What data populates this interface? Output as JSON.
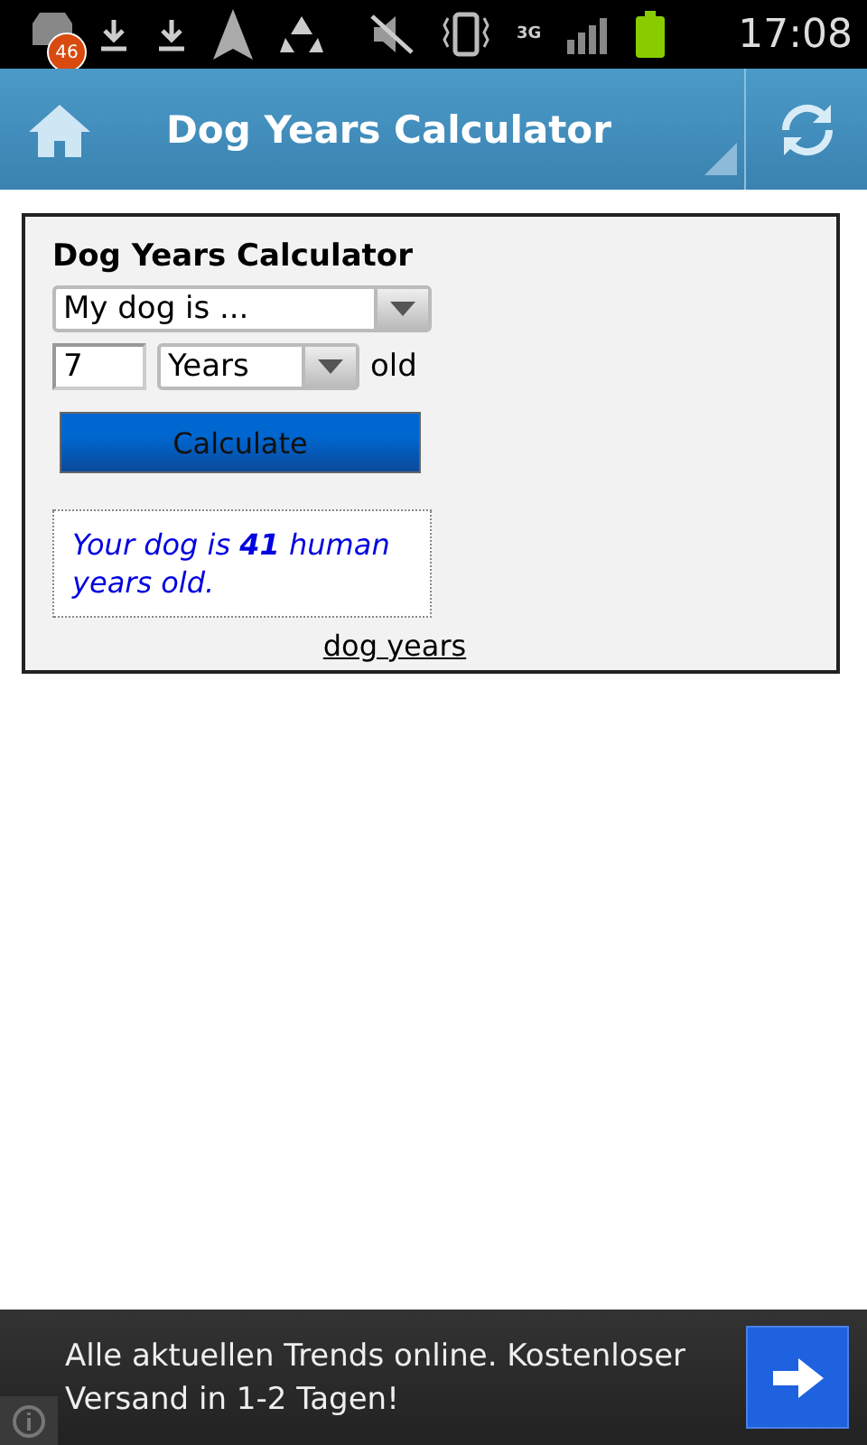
{
  "status_bar": {
    "notification_count": "46",
    "network": "3G",
    "time": "17:08"
  },
  "action_bar": {
    "title": "Dog Years Calculator"
  },
  "calculator": {
    "title": "Dog Years Calculator",
    "mode_select": {
      "value": "My dog is ..."
    },
    "age_field": {
      "value": "7"
    },
    "unit_select": {
      "value": "Years"
    },
    "suffix": "old",
    "button": "Calculate",
    "result": "Your dog is **41** human years old.",
    "link": "dog years"
  },
  "ad": {
    "text": "Alle aktuellen Trends online. Kostenloser Versand in 1-2 Tagen!"
  }
}
